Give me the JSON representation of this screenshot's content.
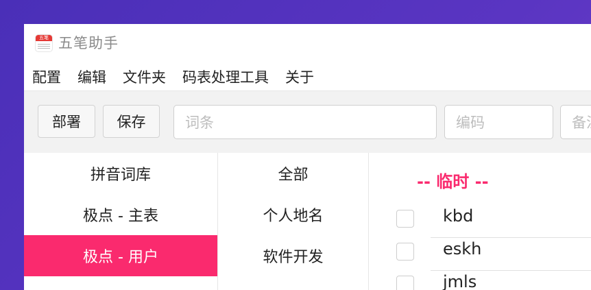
{
  "app": {
    "title": "五笔助手",
    "icon_label": "五笔"
  },
  "menu": {
    "items": [
      "配置",
      "编辑",
      "文件夹",
      "码表处理工具",
      "关于"
    ]
  },
  "toolbar": {
    "deploy_label": "部署",
    "save_label": "保存",
    "word_placeholder": "词条",
    "code_placeholder": "编码",
    "note_placeholder": "备注"
  },
  "dictionaries": {
    "items": [
      "拼音词库",
      "极点 - 主表",
      "极点 - 用户"
    ],
    "active_index": 2
  },
  "groups": {
    "items": [
      "全部",
      "个人地名",
      "软件开发"
    ]
  },
  "word_list": {
    "group_title": "-- 临时 --",
    "codes": [
      "kbd",
      "eskh",
      "jmls"
    ]
  },
  "colors": {
    "accent": "#fa2a6e",
    "background": "#5a35c2"
  },
  "icons": {
    "app": "wubi-app-icon"
  }
}
